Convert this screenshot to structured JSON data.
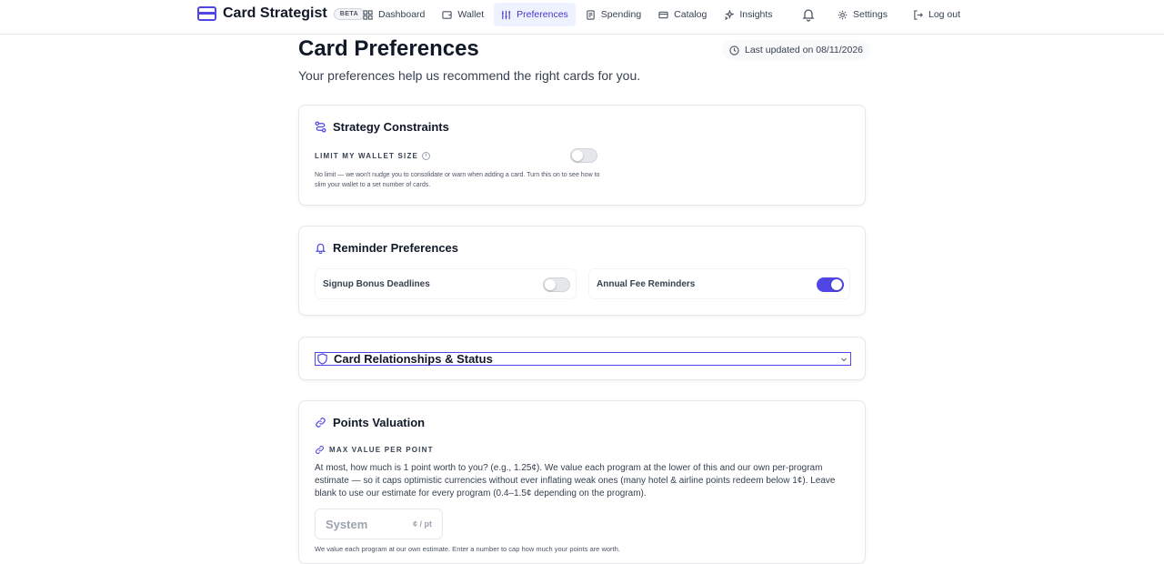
{
  "brand": {
    "name": "Card Strategist",
    "badge": "BETA"
  },
  "nav": [
    {
      "label": "Dashboard",
      "icon": "dashboard-icon"
    },
    {
      "label": "Wallet",
      "icon": "wallet-icon"
    },
    {
      "label": "Preferences",
      "icon": "preferences-icon",
      "active": true
    },
    {
      "label": "Spending",
      "icon": "spending-icon"
    },
    {
      "label": "Catalog",
      "icon": "catalog-icon"
    },
    {
      "label": "Insights",
      "icon": "insights-icon"
    }
  ],
  "header_actions": {
    "settings": "Settings",
    "logout": "Log out",
    "notification_icon": "bell-icon"
  },
  "page": {
    "title": "Card Preferences",
    "subtitle": "Your preferences help us recommend the right cards for you.",
    "last_updated": "Last updated on 08/11/2026"
  },
  "strategy": {
    "title": "Strategy Constraints",
    "limit_label": "LIMIT MY WALLET SIZE",
    "limit_enabled": false,
    "helper": "No limit — we won't nudge you to consolidate or warn when adding a card. Turn this on to see how to slim your wallet to a set number of cards."
  },
  "reminders": {
    "title": "Reminder Preferences",
    "signup_label": "Signup Bonus Deadlines",
    "signup_enabled": false,
    "annual_label": "Annual Fee Reminders",
    "annual_enabled": true
  },
  "relationships": {
    "title": "Card Relationships & Status",
    "expanded": false
  },
  "points": {
    "title": "Points Valuation",
    "max_label": "MAX VALUE PER POINT",
    "description": "At most, how much is 1 point worth to you? (e.g., 1.25¢). We value each program at the lower of this and our own per-program estimate — so it caps optimistic currencies without ever inflating weak ones (many hotel & airline points redeem below 1¢). Leave blank to use our estimate for every program (0.4–1.5¢ depending on the program).",
    "input_placeholder": "System",
    "input_value": "",
    "unit": "¢ / pt",
    "footer": "We value each program at our own estimate. Enter a number to cap how much your points are worth."
  },
  "colors": {
    "accent": "#4f46e5",
    "active_bg": "#eef2ff",
    "border": "#e5e7eb"
  }
}
